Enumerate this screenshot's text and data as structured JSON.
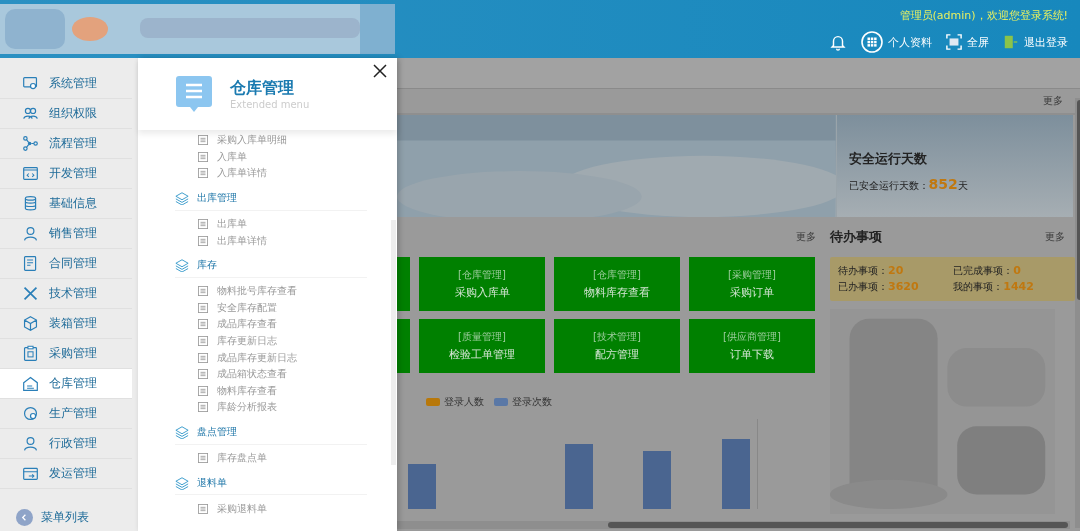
{
  "header": {
    "welcome": "管理员(admin)，欢迎您登录系统!",
    "actions": [
      {
        "kind": "bell"
      },
      {
        "kind": "profile",
        "label": "个人资料"
      },
      {
        "kind": "fullscreen",
        "label": "全屏"
      },
      {
        "kind": "logout",
        "label": "退出登录"
      }
    ]
  },
  "sidebar": {
    "items": [
      {
        "label": "系统管理",
        "selected": false
      },
      {
        "label": "组织权限",
        "selected": false
      },
      {
        "label": "流程管理",
        "selected": false
      },
      {
        "label": "开发管理",
        "selected": false
      },
      {
        "label": "基础信息",
        "selected": false
      },
      {
        "label": "销售管理",
        "selected": false
      },
      {
        "label": "合同管理",
        "selected": false
      },
      {
        "label": "技术管理",
        "selected": false
      },
      {
        "label": "装箱管理",
        "selected": false
      },
      {
        "label": "采购管理",
        "selected": false
      },
      {
        "label": "仓库管理",
        "selected": true
      },
      {
        "label": "生产管理",
        "selected": false
      },
      {
        "label": "行政管理",
        "selected": false
      },
      {
        "label": "发运管理",
        "selected": false
      }
    ],
    "footer": "菜单列表"
  },
  "flyout": {
    "title": "仓库管理",
    "subtitle": "Extended menu",
    "groups": [
      {
        "children": [
          {
            "label": "采购入库单明细"
          },
          {
            "label": "入库单"
          },
          {
            "label": "入库单详情"
          }
        ]
      },
      {
        "title": "出库管理",
        "children": [
          {
            "label": "出库单"
          },
          {
            "label": "出库单详情"
          }
        ]
      },
      {
        "title": "库存",
        "children": [
          {
            "label": "物料批号库存查看"
          },
          {
            "label": "安全库存配置"
          },
          {
            "label": "成品库存查看"
          },
          {
            "label": "库存更新日志"
          },
          {
            "label": "成品库存更新日志"
          },
          {
            "label": "成品箱状态查看"
          },
          {
            "label": "物料库存查看"
          },
          {
            "label": "库龄分析报表"
          }
        ]
      },
      {
        "title": "盘点管理",
        "children": [
          {
            "label": "库存盘点单"
          }
        ]
      },
      {
        "title": "退料单",
        "children": [
          {
            "label": "采购退料单"
          }
        ]
      }
    ]
  },
  "main": {
    "top_more": "更多",
    "safety": {
      "title": "安全运行天数",
      "label": "已安全运行天数：",
      "days": "852",
      "unit": "天"
    },
    "shortcuts": {
      "more": "更多",
      "tiles": [
        {
          "category": "[仓库管理]",
          "title": "采购入库单"
        },
        {
          "category": "[仓库管理]",
          "title": "物料库存查看"
        },
        {
          "category": "[采购管理]",
          "title": "采购订单"
        },
        {
          "category": "[质量管理]",
          "title": "检验工单管理"
        },
        {
          "category": "[技术管理]",
          "title": "配方管理"
        },
        {
          "category": "[供应商管理]",
          "title": "订单下载"
        }
      ]
    },
    "legend": [
      {
        "label": "登录人数",
        "color": "#b8780a"
      },
      {
        "label": "登录次数",
        "color": "#5a78a6"
      }
    ],
    "todo": {
      "title": "待办事项",
      "more": "更多",
      "stats": [
        {
          "label": "待办事项：",
          "value": "20"
        },
        {
          "label": "已完成事项：",
          "value": "0"
        },
        {
          "label": "已办事项：",
          "value": "3620"
        },
        {
          "label": "我的事项：",
          "value": "1442"
        }
      ]
    }
  }
}
